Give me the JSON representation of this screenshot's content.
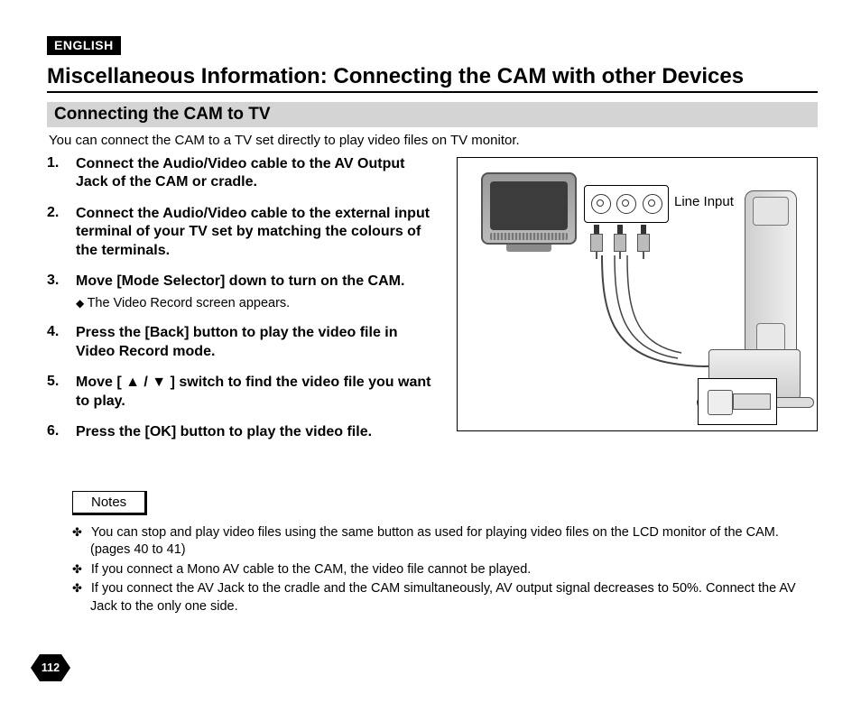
{
  "language_badge": "ENGLISH",
  "page_title": "Miscellaneous Information: Connecting the CAM with other Devices",
  "section_title": "Connecting the CAM to TV",
  "intro": "You can connect the CAM to a TV set directly to play video files on TV monitor.",
  "steps": [
    {
      "num": "1.",
      "text": "Connect the Audio/Video cable to the AV Output Jack of the CAM or cradle."
    },
    {
      "num": "2.",
      "text": "Connect the Audio/Video cable to the external input terminal of your TV set by matching the colours of the terminals."
    },
    {
      "num": "3.",
      "text": "Move [Mode Selector] down to turn on the CAM.",
      "sub": "The Video Record screen appears."
    },
    {
      "num": "4.",
      "text": "Press the [Back] button to play the video file in Video Record mode."
    },
    {
      "num": "5.",
      "text": "Move [ ▲ / ▼ ] switch to find the video file you want to play."
    },
    {
      "num": "6.",
      "text": "Press the [OK] button to play the video file."
    }
  ],
  "figure": {
    "line_input_label": "Line Input"
  },
  "notes_label": "Notes",
  "notes": [
    "You can stop and play video files using the same button as used for playing video files on the LCD monitor of the CAM. (pages 40 to 41)",
    "If you connect a Mono AV cable to the CAM, the video file cannot be played.",
    "If you connect the AV Jack to the cradle and the CAM simultaneously, AV output signal decreases to 50%. Connect the AV Jack to the only one side."
  ],
  "page_number": "112"
}
